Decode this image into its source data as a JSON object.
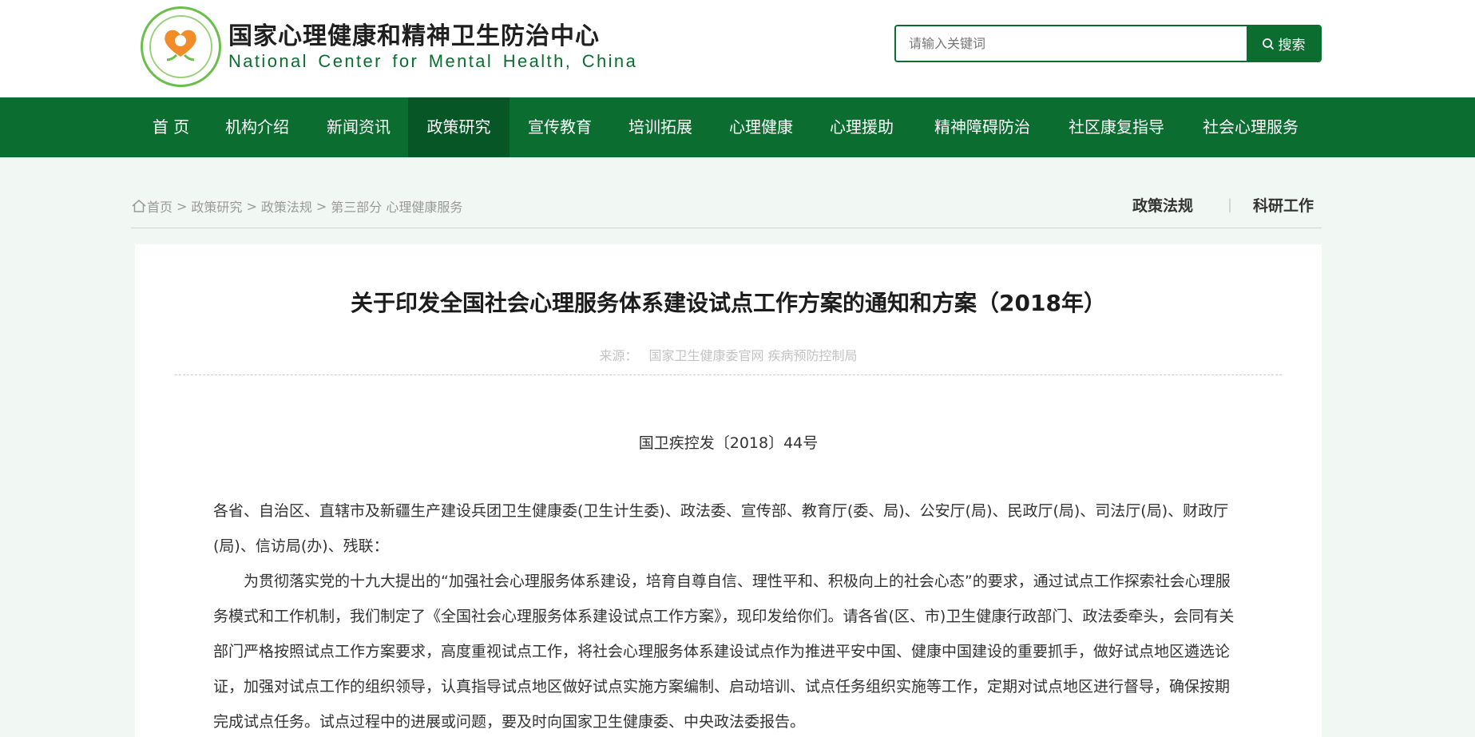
{
  "header": {
    "title_cn": "国家心理健康和精神卫生防治中心",
    "title_en": "National Center for Mental Health, China",
    "search_placeholder": "请输入关键词",
    "search_label": "搜索"
  },
  "nav": {
    "items": [
      "首 页",
      "机构介绍",
      "新闻资讯",
      "政策研究",
      "宣传教育",
      "培训拓展",
      "心理健康",
      "心理援助",
      "精神障碍防治",
      "社区康复指导",
      "社会心理服务"
    ],
    "active": "政策研究"
  },
  "breadcrumb": {
    "items": [
      "首页",
      "政策研究",
      "政策法规",
      "第三部分 心理健康服务"
    ],
    "separator": ">"
  },
  "subnav": {
    "items": [
      "政策法规",
      "科研工作"
    ],
    "divider": "|"
  },
  "article": {
    "title": "关于印发全国社会心理服务体系建设试点工作方案的通知和方案（2018年）",
    "source_label": "来源：",
    "source_value": "国家卫生健康委官网 疾病预防控制局",
    "doc_number": "国卫疾控发〔2018〕44号",
    "paragraphs": [
      "各省、自治区、直辖市及新疆生产建设兵团卫生健康委(卫生计生委)、政法委、宣传部、教育厅(委、局)、公安厅(局)、民政厅(局)、司法厅(局)、财政厅(局)、信访局(办)、残联：",
      "为贯彻落实党的十九大提出的“加强社会心理服务体系建设，培育自尊自信、理性平和、积极向上的社会心态”的要求，通过试点工作探索社会心理服务模式和工作机制，我们制定了《全国社会心理服务体系建设试点工作方案》，现印发给你们。请各省(区、市)卫生健康行政部门、政法委牵头，会同有关部门严格按照试点工作方案要求，高度重视试点工作，将社会心理服务体系建设试点作为推进平安中国、健康中国建设的重要抓手，做好试点地区遴选论证，加强对试点工作的组织领导，认真指导试点地区做好试点实施方案编制、启动培训、试点任务组织实施等工作，定期对试点地区进行督导，确保按期完成试点任务。试点过程中的进展或问题，要及时向国家卫生健康委、中央政法委报告。"
    ]
  },
  "colors": {
    "brand_green": "#0b6e30",
    "nav_active": "#075626",
    "page_bg": "#f1f7f3"
  },
  "icons": {
    "logo": "mental-health-heart-logo",
    "search": "search-icon",
    "home": "home-icon"
  }
}
